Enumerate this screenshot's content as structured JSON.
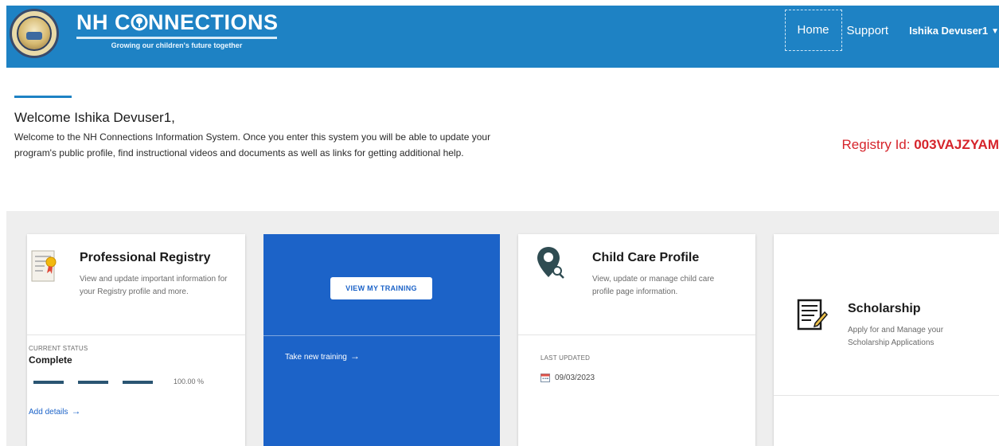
{
  "header": {
    "brand_title": "NH CONNECTIONS",
    "brand_prefix": "NH C",
    "brand_suffix": "NNECTIONS",
    "tagline": "Growing our children's future together",
    "nav": {
      "home": "Home",
      "support": "Support",
      "user": "Ishika Devuser1"
    },
    "colors": {
      "bar": "#1e82c4"
    }
  },
  "welcome": {
    "title": "Welcome Ishika Devuser1,",
    "body": "Welcome to the NH Connections Information System. Once you enter this system you will be able to update your program's public profile, find instructional videos and documents as well as links for getting additional help.",
    "registry_label": "Registry Id: ",
    "registry_id": "003VAJZYAM",
    "registry_color": "#d6242b"
  },
  "cards": {
    "professional_registry": {
      "title": "Professional Registry",
      "description": "View and update important information for your Registry profile and more.",
      "status_label": "CURRENT STATUS",
      "status_value": "Complete",
      "progress_text": "100.00 %",
      "progress": 1.0,
      "link": "Add details"
    },
    "training": {
      "button": "VIEW MY TRAINING",
      "link": "Take new training",
      "color": "#1c63c8"
    },
    "child_care": {
      "title": "Child Care Profile",
      "description": "View, update or manage child care profile page information.",
      "updated_label": "LAST UPDATED",
      "updated_value": "09/03/2023"
    },
    "scholarship": {
      "title": "Scholarship",
      "description": "Apply for and Manage your Scholarship Applications"
    }
  },
  "icons": {
    "seal": "state-seal-logo",
    "brand_o": "tree-o-mark",
    "certificate": "certificate-icon",
    "location": "location-pin-icon",
    "document": "document-list-icon",
    "calendar": "calendar-icon",
    "arrow": "arrow-right-icon",
    "caret": "caret-down-icon"
  }
}
